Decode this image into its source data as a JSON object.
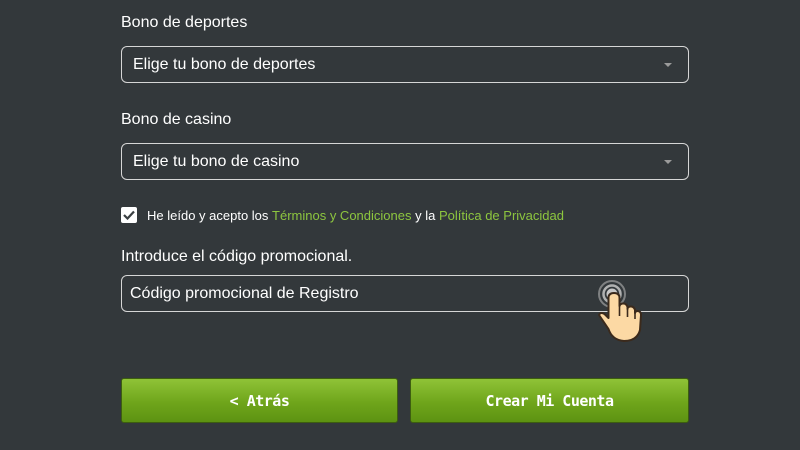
{
  "sports_bonus": {
    "label": "Bono de deportes",
    "selected": "Elige tu bono de deportes"
  },
  "casino_bonus": {
    "label": "Bono de casino",
    "selected": "Elige tu bono de casino"
  },
  "consent": {
    "checked": true,
    "text_before": "He leído y acepto los ",
    "terms_link": "Términos y Condiciones",
    "text_middle": " y la ",
    "privacy_link": "Política de Privacidad"
  },
  "promo": {
    "label": "Introduce el código promocional.",
    "placeholder": "Código promocional de Registro"
  },
  "buttons": {
    "back_label": "< Atrás",
    "create_label": "Crear Mi Cuenta"
  },
  "colors": {
    "background": "#33383b",
    "link": "#8dc63f",
    "button_green": "#6fa51b"
  },
  "icons": {
    "pointer": "hand-pointer-icon",
    "checkbox": "checkmark-icon",
    "dropdown": "chevron-down-icon"
  }
}
